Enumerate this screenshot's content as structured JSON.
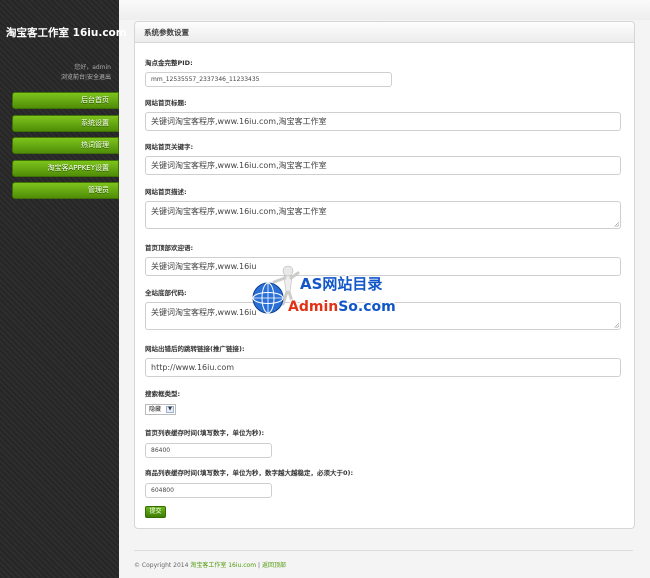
{
  "sidebar": {
    "brand": "淘宝客工作室 16iu.com",
    "greeting": "您好，admin",
    "links": [
      "浏览前台",
      "安全退出"
    ],
    "links_sep": "|",
    "menu": [
      "后台首页",
      "系统设置",
      "热词管理",
      "淘宝客APPKEY设置",
      "管理员"
    ]
  },
  "panel": {
    "title": "系统参数设置"
  },
  "form": {
    "pid": {
      "label": "淘点金完整PID:",
      "value": "mm_12535557_2337346_11233435"
    },
    "site_title": {
      "label": "网站首页标题:",
      "value": "关键词淘宝客程序,www.16iu.com,淘宝客工作室"
    },
    "site_keywords": {
      "label": "网站首页关键字:",
      "value": "关键词淘宝客程序,www.16iu.com,淘宝客工作室"
    },
    "site_description": {
      "label": "网站首页描述:",
      "value": "关键词淘宝客程序,www.16iu.com,淘宝客工作室"
    },
    "home_top_welcome": {
      "label": "首页顶部欢迎语:",
      "value": "关键词淘宝客程序,www.16iu"
    },
    "footer_code": {
      "label": "全站底部代码:",
      "value": "关键词淘宝客程序,www.16iu"
    },
    "exit_link": {
      "label": "网站出错后的跳转链接(推广链接):",
      "value": "http://www.16iu.com"
    },
    "search_type": {
      "label": "搜索框类型:",
      "value": "隐藏"
    },
    "home_cache": {
      "label": "首页列表缓存时间(填写数字，单位为秒):",
      "value": "86400"
    },
    "product_cache": {
      "label": "商品列表缓存时间(填写数字，单位为秒，数字越大越稳定，必须大于0):",
      "value": "604800"
    },
    "submit_label": "提交"
  },
  "footer": {
    "copyright": "© Copyright 2014",
    "studio_link": "淘宝客工作室 16iu.com",
    "sep": "|",
    "top_link": "返回顶部"
  },
  "watermark": {
    "line1": "AS网站目录",
    "line2_red": "Admin",
    "line2_blue": "So.com"
  }
}
